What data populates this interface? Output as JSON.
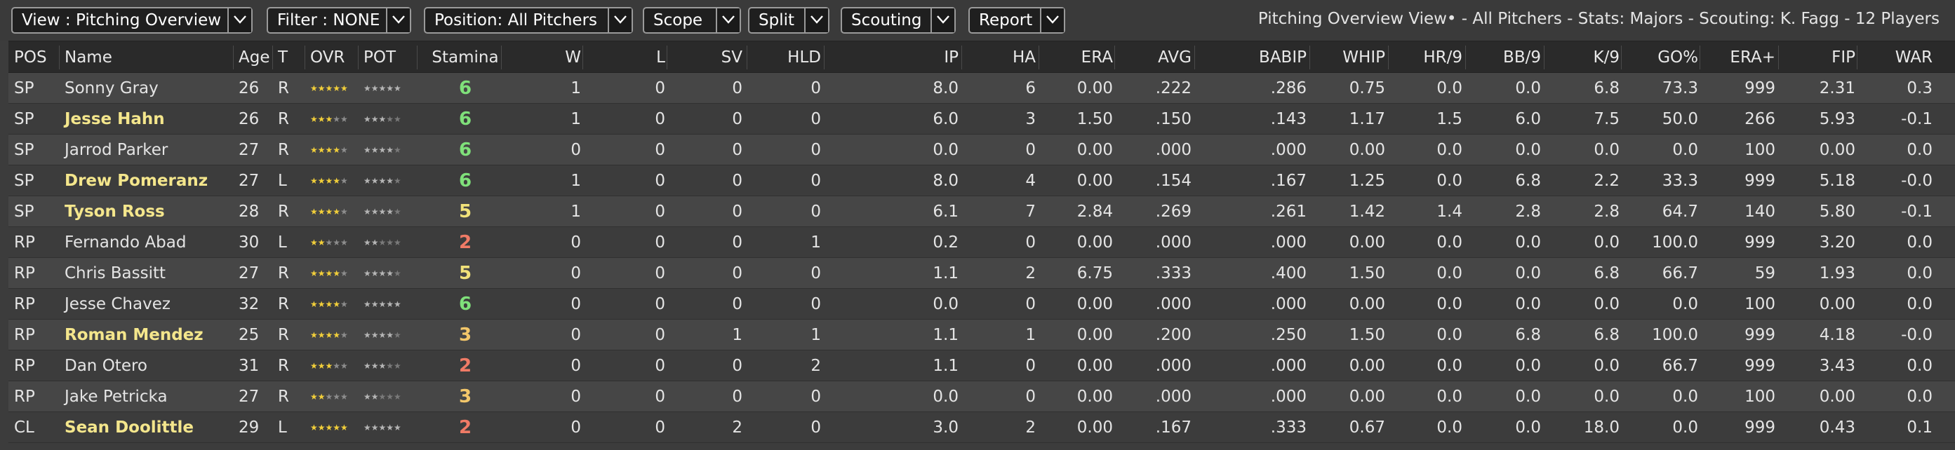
{
  "colors": {
    "highlight_name": "#f4e68c",
    "stamina_green": "#7fe07a",
    "stamina_yellow": "#f1e27a",
    "stamina_red": "#f07b66",
    "star_gold": "#f2cf3a",
    "star_grey": "#8d8d8d"
  },
  "toolbar": {
    "view": "View : Pitching Overview",
    "filter": "Filter : NONE",
    "position": "Position: All Pitchers",
    "scope": "Scope",
    "split": "Split",
    "scouting": "Scouting",
    "report": "Report",
    "view_description": "Pitching Overview View• - All Pitchers - Stats: Majors - Scouting: K. Fagg - 12 Players",
    "dropdown_icon": "chevron-down-icon"
  },
  "table": {
    "headers": {
      "pos": "POS",
      "name": "Name",
      "age": "Age",
      "t": "T",
      "ovr": "OVR",
      "pot": "POT",
      "stamina": "Stamina",
      "w": "W",
      "l": "L",
      "sv": "SV",
      "hld": "HLD",
      "ip": "IP",
      "ha": "HA",
      "era": "ERA",
      "avg": "AVG",
      "babip": "BABIP",
      "whip": "WHIP",
      "hr9": "HR/9",
      "bb9": "BB/9",
      "k9": "K/9",
      "go": "GO%",
      "eraplus": "ERA+",
      "fip": "FIP",
      "war": "WAR"
    },
    "rows": [
      {
        "pos": "SP",
        "name": "Sonny Gray",
        "highlight": false,
        "age": "26",
        "t": "R",
        "ovr": 4.5,
        "pot": 4.5,
        "stamina": "6",
        "stamina_color": "green",
        "w": "1",
        "l": "0",
        "sv": "0",
        "hld": "0",
        "ip": "8.0",
        "ha": "6",
        "era": "0.00",
        "avg": ".222",
        "babip": ".286",
        "whip": "0.75",
        "hr9": "0.0",
        "bb9": "0.0",
        "k9": "6.8",
        "go": "73.3",
        "eraplus": "999",
        "fip": "2.31",
        "war": "0.3"
      },
      {
        "pos": "SP",
        "name": "Jesse Hahn",
        "highlight": true,
        "age": "26",
        "t": "R",
        "ovr": 2.5,
        "pot": 2.5,
        "stamina": "6",
        "stamina_color": "green",
        "w": "1",
        "l": "0",
        "sv": "0",
        "hld": "0",
        "ip": "6.0",
        "ha": "3",
        "era": "1.50",
        "avg": ".150",
        "babip": ".143",
        "whip": "1.17",
        "hr9": "1.5",
        "bb9": "6.0",
        "k9": "7.5",
        "go": "50.0",
        "eraplus": "266",
        "fip": "5.93",
        "war": "-0.1"
      },
      {
        "pos": "SP",
        "name": "Jarrod Parker",
        "highlight": false,
        "age": "27",
        "t": "R",
        "ovr": 3.5,
        "pot": 4.0,
        "stamina": "6",
        "stamina_color": "green",
        "w": "0",
        "l": "0",
        "sv": "0",
        "hld": "0",
        "ip": "0.0",
        "ha": "0",
        "era": "0.00",
        "avg": ".000",
        "babip": ".000",
        "whip": "0.00",
        "hr9": "0.0",
        "bb9": "0.0",
        "k9": "0.0",
        "go": "0.0",
        "eraplus": "100",
        "fip": "0.00",
        "war": "0.0"
      },
      {
        "pos": "SP",
        "name": "Drew Pomeranz",
        "highlight": true,
        "age": "27",
        "t": "L",
        "ovr": 3.5,
        "pot": 4.0,
        "stamina": "6",
        "stamina_color": "green",
        "w": "1",
        "l": "0",
        "sv": "0",
        "hld": "0",
        "ip": "8.0",
        "ha": "4",
        "era": "0.00",
        "avg": ".154",
        "babip": ".167",
        "whip": "1.25",
        "hr9": "0.0",
        "bb9": "6.8",
        "k9": "2.2",
        "go": "33.3",
        "eraplus": "999",
        "fip": "5.18",
        "war": "-0.0"
      },
      {
        "pos": "SP",
        "name": "Tyson Ross",
        "highlight": true,
        "age": "28",
        "t": "R",
        "ovr": 4.0,
        "pot": 4.0,
        "stamina": "5",
        "stamina_color": "yellow",
        "w": "1",
        "l": "0",
        "sv": "0",
        "hld": "0",
        "ip": "6.1",
        "ha": "7",
        "era": "2.84",
        "avg": ".269",
        "babip": ".261",
        "whip": "1.42",
        "hr9": "1.4",
        "bb9": "2.8",
        "k9": "2.8",
        "go": "64.7",
        "eraplus": "140",
        "fip": "5.80",
        "war": "-0.1"
      },
      {
        "pos": "RP",
        "name": "Fernando Abad",
        "highlight": false,
        "age": "30",
        "t": "L",
        "ovr": 2.0,
        "pot": 2.0,
        "stamina": "2",
        "stamina_color": "red",
        "w": "0",
        "l": "0",
        "sv": "0",
        "hld": "1",
        "ip": "0.2",
        "ha": "0",
        "era": "0.00",
        "avg": ".000",
        "babip": ".000",
        "whip": "0.00",
        "hr9": "0.0",
        "bb9": "0.0",
        "k9": "0.0",
        "go": "100.0",
        "eraplus": "999",
        "fip": "3.20",
        "war": "0.0"
      },
      {
        "pos": "RP",
        "name": "Chris Bassitt",
        "highlight": false,
        "age": "27",
        "t": "R",
        "ovr": 4.0,
        "pot": 4.0,
        "stamina": "5",
        "stamina_color": "yellow",
        "w": "0",
        "l": "0",
        "sv": "0",
        "hld": "0",
        "ip": "1.1",
        "ha": "2",
        "era": "6.75",
        "avg": ".333",
        "babip": ".400",
        "whip": "1.50",
        "hr9": "0.0",
        "bb9": "0.0",
        "k9": "6.8",
        "go": "66.7",
        "eraplus": "59",
        "fip": "1.93",
        "war": "0.0"
      },
      {
        "pos": "RP",
        "name": "Jesse Chavez",
        "highlight": false,
        "age": "32",
        "t": "R",
        "ovr": 3.5,
        "pot": 4.5,
        "stamina": "6",
        "stamina_color": "green",
        "w": "0",
        "l": "0",
        "sv": "0",
        "hld": "0",
        "ip": "0.0",
        "ha": "0",
        "era": "0.00",
        "avg": ".000",
        "babip": ".000",
        "whip": "0.00",
        "hr9": "0.0",
        "bb9": "0.0",
        "k9": "0.0",
        "go": "0.0",
        "eraplus": "100",
        "fip": "0.00",
        "war": "0.0"
      },
      {
        "pos": "RP",
        "name": "Roman Mendez",
        "highlight": true,
        "age": "25",
        "t": "R",
        "ovr": 4.0,
        "pot": 4.0,
        "stamina": "3",
        "stamina_color": "orange",
        "w": "0",
        "l": "0",
        "sv": "1",
        "hld": "1",
        "ip": "1.1",
        "ha": "1",
        "era": "0.00",
        "avg": ".200",
        "babip": ".250",
        "whip": "1.50",
        "hr9": "0.0",
        "bb9": "6.8",
        "k9": "6.8",
        "go": "100.0",
        "eraplus": "999",
        "fip": "4.18",
        "war": "-0.0"
      },
      {
        "pos": "RP",
        "name": "Dan Otero",
        "highlight": false,
        "age": "31",
        "t": "R",
        "ovr": 2.5,
        "pot": 2.5,
        "stamina": "2",
        "stamina_color": "red",
        "w": "0",
        "l": "0",
        "sv": "0",
        "hld": "2",
        "ip": "1.1",
        "ha": "0",
        "era": "0.00",
        "avg": ".000",
        "babip": ".000",
        "whip": "0.00",
        "hr9": "0.0",
        "bb9": "0.0",
        "k9": "0.0",
        "go": "66.7",
        "eraplus": "999",
        "fip": "3.43",
        "war": "0.0"
      },
      {
        "pos": "RP",
        "name": "Jake Petricka",
        "highlight": false,
        "age": "27",
        "t": "R",
        "ovr": 1.5,
        "pot": 2.0,
        "stamina": "3",
        "stamina_color": "orange",
        "w": "0",
        "l": "0",
        "sv": "0",
        "hld": "0",
        "ip": "0.0",
        "ha": "0",
        "era": "0.00",
        "avg": ".000",
        "babip": ".000",
        "whip": "0.00",
        "hr9": "0.0",
        "bb9": "0.0",
        "k9": "0.0",
        "go": "0.0",
        "eraplus": "100",
        "fip": "0.00",
        "war": "0.0"
      },
      {
        "pos": "CL",
        "name": "Sean Doolittle",
        "highlight": true,
        "age": "29",
        "t": "L",
        "ovr": 5.0,
        "pot": 5.0,
        "stamina": "2",
        "stamina_color": "red",
        "w": "0",
        "l": "0",
        "sv": "2",
        "hld": "0",
        "ip": "3.0",
        "ha": "2",
        "era": "0.00",
        "avg": ".167",
        "babip": ".333",
        "whip": "0.67",
        "hr9": "0.0",
        "bb9": "0.0",
        "k9": "18.0",
        "go": "0.0",
        "eraplus": "999",
        "fip": "0.43",
        "war": "0.1"
      }
    ]
  }
}
